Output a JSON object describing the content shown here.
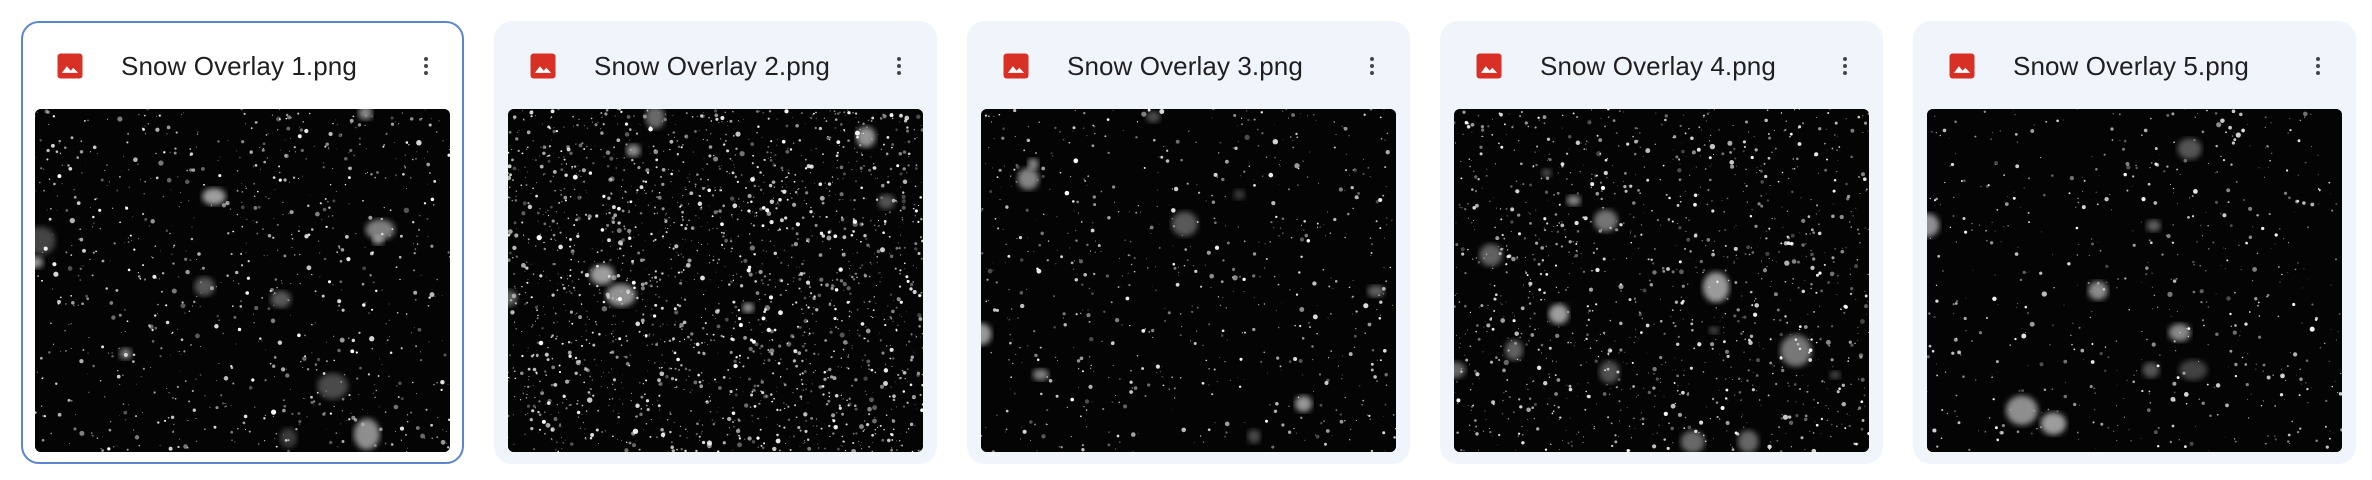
{
  "colors": {
    "card_background": "#f0f4fb",
    "selected_border": "#5b86cf",
    "image_icon_red": "#d93025",
    "text": "#1f1f1f"
  },
  "files": [
    {
      "name": "Snow Overlay 1.png",
      "icon": "image-file-icon",
      "selected": true
    },
    {
      "name": "Snow Overlay 2.png",
      "icon": "image-file-icon",
      "selected": false
    },
    {
      "name": "Snow Overlay 3.png",
      "icon": "image-file-icon",
      "selected": false
    },
    {
      "name": "Snow Overlay 4.png",
      "icon": "image-file-icon",
      "selected": false
    },
    {
      "name": "Snow Overlay 5.png",
      "icon": "image-file-icon",
      "selected": false
    }
  ],
  "more_icon": "more-vert-icon"
}
